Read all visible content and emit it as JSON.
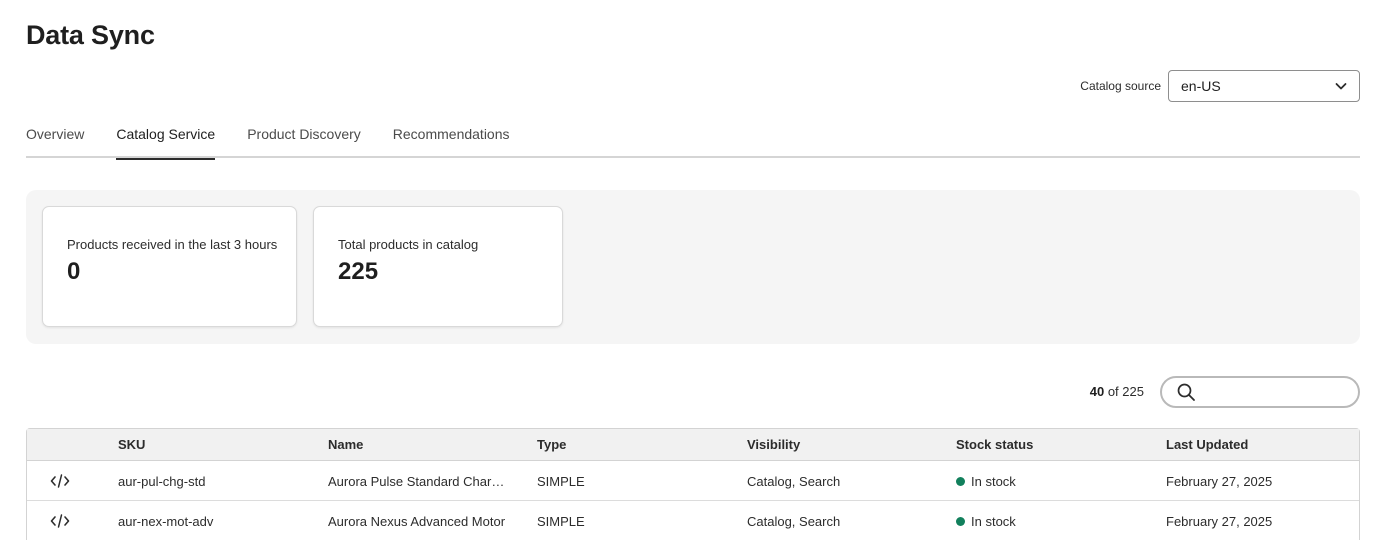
{
  "page": {
    "title": "Data Sync"
  },
  "catalog_source": {
    "label": "Catalog source",
    "value": "en-US"
  },
  "tabs": [
    {
      "label": "Overview",
      "active": false
    },
    {
      "label": "Catalog Service",
      "active": true
    },
    {
      "label": "Product Discovery",
      "active": false
    },
    {
      "label": "Recommendations",
      "active": false
    }
  ],
  "stats": [
    {
      "label": "Products received in the last 3 hours",
      "value": "0"
    },
    {
      "label": "Total products in catalog",
      "value": "225"
    }
  ],
  "results": {
    "shown": "40",
    "of_text": "of",
    "total": "225"
  },
  "search": {
    "placeholder": ""
  },
  "table": {
    "columns": [
      "SKU",
      "Name",
      "Type",
      "Visibility",
      "Stock status",
      "Last Updated"
    ],
    "rows": [
      {
        "sku": "aur-pul-chg-std",
        "name": "Aurora Pulse Standard Charg...",
        "type": "SIMPLE",
        "visibility": "Catalog, Search",
        "stock": "In stock",
        "updated": "February 27, 2025"
      },
      {
        "sku": "aur-nex-mot-adv",
        "name": "Aurora Nexus Advanced Motor",
        "type": "SIMPLE",
        "visibility": "Catalog, Search",
        "stock": "In stock",
        "updated": "February 27, 2025"
      }
    ]
  },
  "icons": {
    "row_action": "code-icon",
    "search": "search-icon",
    "dropdown": "chevron-down-icon",
    "stock_indicator": "status-dot-icon"
  },
  "colors": {
    "in_stock": "#12805c",
    "tab_indicator": "#2c2c2c",
    "panel_bg": "#f5f5f5"
  }
}
